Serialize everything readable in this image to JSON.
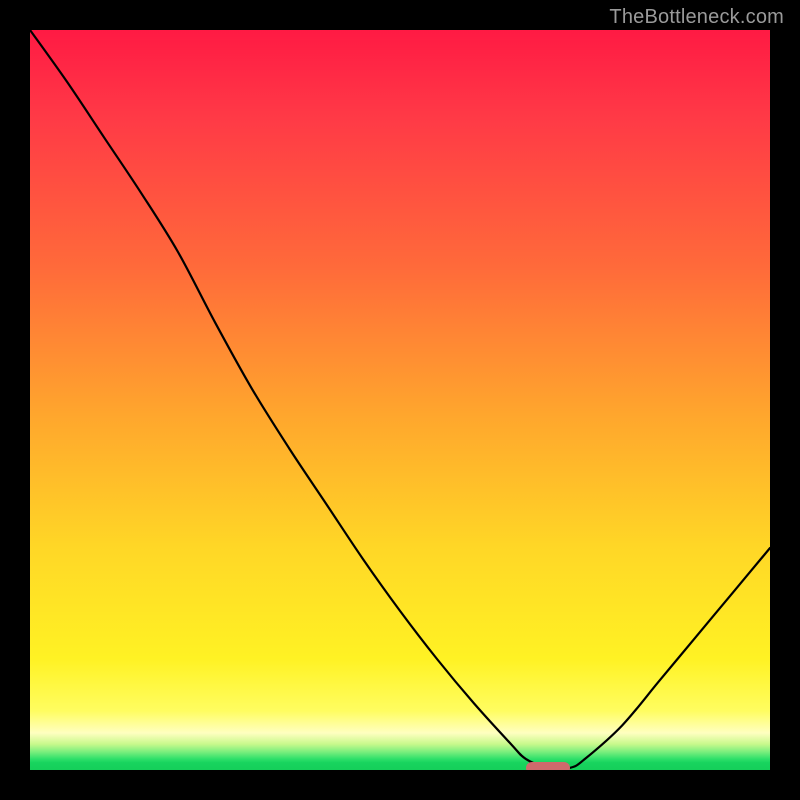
{
  "watermark": "TheBottleneck.com",
  "colors": {
    "frame": "#000000",
    "curve": "#000000",
    "marker": "#ce6a6c",
    "gradient_top": "#ff1a44",
    "gradient_bottom": "#15cf5a"
  },
  "chart_data": {
    "type": "line",
    "title": "",
    "xlabel": "",
    "ylabel": "",
    "xlim": [
      0,
      100
    ],
    "ylim": [
      0,
      100
    ],
    "grid": false,
    "legend": false,
    "x": [
      0,
      5,
      10,
      15,
      20,
      25,
      30,
      35,
      40,
      45,
      50,
      55,
      60,
      65,
      67,
      70,
      73,
      75,
      80,
      85,
      90,
      95,
      100
    ],
    "y": [
      100,
      93,
      85.5,
      78,
      70,
      60.5,
      51.5,
      43.5,
      36,
      28.5,
      21.5,
      15,
      9,
      3.5,
      1.5,
      0.3,
      0.3,
      1.5,
      6,
      12,
      18,
      24,
      30
    ],
    "optimum_x_range": [
      67,
      73
    ],
    "optimum_y": 0.3,
    "annotations": []
  }
}
